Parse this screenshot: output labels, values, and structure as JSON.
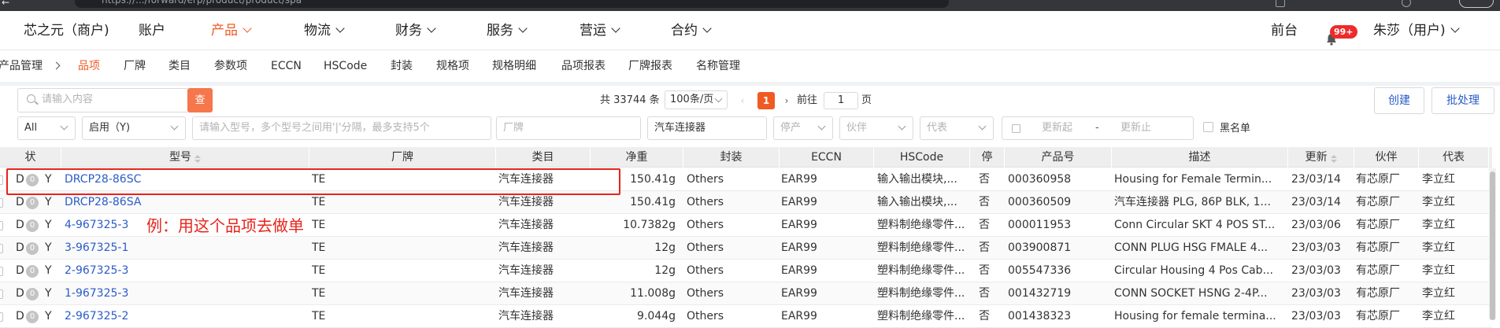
{
  "browser": {
    "url": "https://.../forward/erp/product/product/spa"
  },
  "topnav": {
    "brand": "芯之元（商户)",
    "items": [
      {
        "label": "账户",
        "dropdown": false,
        "active": false
      },
      {
        "label": "产品",
        "dropdown": true,
        "active": true
      },
      {
        "label": "物流",
        "dropdown": true,
        "active": false
      },
      {
        "label": "财务",
        "dropdown": true,
        "active": false
      },
      {
        "label": "服务",
        "dropdown": true,
        "active": false
      },
      {
        "label": "营运",
        "dropdown": true,
        "active": false
      },
      {
        "label": "合约",
        "dropdown": true,
        "active": false
      }
    ],
    "front_desk": "前台",
    "notifications_badge": "99+",
    "user": "朱莎（用户)"
  },
  "subnav": {
    "breadcrumb_root": "产品管理",
    "tabs": [
      "品项",
      "厂牌",
      "类目",
      "参数项",
      "ECCN",
      "HSCode",
      "封装",
      "规格项",
      "规格明细",
      "品项报表",
      "厂牌报表",
      "名称管理"
    ],
    "active": "品项"
  },
  "toolbar": {
    "search_placeholder": "请输入内容",
    "search_button": "查",
    "total_text": "共 33744 条",
    "page_size": "100条/页",
    "current_page": "1",
    "goto_label": "前往",
    "goto_value": "1",
    "goto_suffix": "页",
    "create_button": "创建",
    "batch_button": "批处理"
  },
  "filters": {
    "scope": "All",
    "enabled": "启用（Y)",
    "model_placeholder": "请输入型号，多个型号之间用'|'分隔，最多支持5个",
    "brand_placeholder": "厂牌",
    "category_value": "汽车连接器",
    "stop_placeholder": "停产",
    "partner_placeholder": "伙伴",
    "rep_placeholder": "代表",
    "update_start_placeholder": "更新起",
    "date_sep": "-",
    "update_end_placeholder": "更新止",
    "blacklist_label": "黑名单"
  },
  "table": {
    "headers": {
      "status": "状",
      "model": "型号",
      "brand": "厂牌",
      "category": "类目",
      "weight": "净重",
      "package": "封装",
      "eccn": "ECCN",
      "hscode": "HSCode",
      "stop": "停",
      "product_no": "产品号",
      "desc": "描述",
      "updated": "更新",
      "partner": "伙伴",
      "rep": "代表"
    },
    "rows": [
      {
        "s1": "D",
        "s2": "0",
        "s3": "Y",
        "model": "DRCP28-86SC",
        "brand": "TE",
        "category": "汽车连接器",
        "weight": "150.41g",
        "package": "Others",
        "eccn": "EAR99",
        "hscode": "输入输出模块,...",
        "stop": "否",
        "product_no": "000360958",
        "desc": "Housing for Female Termin...",
        "updated": "23/03/14",
        "partner": "有芯原厂",
        "rep": "李立红"
      },
      {
        "s1": "D",
        "s2": "0",
        "s3": "Y",
        "model": "DRCP28-86SA",
        "brand": "TE",
        "category": "汽车连接器",
        "weight": "150.41g",
        "package": "Others",
        "eccn": "EAR99",
        "hscode": "输入输出模块,...",
        "stop": "否",
        "product_no": "000360509",
        "desc": "汽车连接器 PLG, 86P BLK, 1...",
        "updated": "23/03/14",
        "partner": "有芯原厂",
        "rep": "李立红"
      },
      {
        "s1": "D",
        "s2": "0",
        "s3": "Y",
        "model": "4-967325-3",
        "brand": "TE",
        "category": "汽车连接器",
        "weight": "10.7382g",
        "package": "Others",
        "eccn": "EAR99",
        "hscode": "塑料制绝缘零件...",
        "stop": "否",
        "product_no": "000011953",
        "desc": "Conn Circular SKT 4 POS ST...",
        "updated": "23/03/06",
        "partner": "有芯原厂",
        "rep": "李立红"
      },
      {
        "s1": "D",
        "s2": "0",
        "s3": "Y",
        "model": "3-967325-1",
        "brand": "TE",
        "category": "汽车连接器",
        "weight": "12g",
        "package": "Others",
        "eccn": "EAR99",
        "hscode": "塑料制绝缘零件...",
        "stop": "否",
        "product_no": "003900871",
        "desc": "CONN PLUG HSG FMALE 4...",
        "updated": "23/03/03",
        "partner": "有芯原厂",
        "rep": "李立红"
      },
      {
        "s1": "D",
        "s2": "0",
        "s3": "Y",
        "model": "2-967325-3",
        "brand": "TE",
        "category": "汽车连接器",
        "weight": "12g",
        "package": "Others",
        "eccn": "EAR99",
        "hscode": "塑料制绝缘零件...",
        "stop": "否",
        "product_no": "005547336",
        "desc": "Circular Housing 4 Pos Cab...",
        "updated": "23/03/03",
        "partner": "有芯原厂",
        "rep": "李立红"
      },
      {
        "s1": "D",
        "s2": "0",
        "s3": "Y",
        "model": "1-967325-3",
        "brand": "TE",
        "category": "汽车连接器",
        "weight": "11.008g",
        "package": "Others",
        "eccn": "EAR99",
        "hscode": "塑料制绝缘零件...",
        "stop": "否",
        "product_no": "001432719",
        "desc": "CONN SOCKET HSNG 2-4P...",
        "updated": "23/03/03",
        "partner": "有芯原厂",
        "rep": "李立红"
      },
      {
        "s1": "D",
        "s2": "0",
        "s3": "Y",
        "model": "2-967325-2",
        "brand": "TE",
        "category": "汽车连接器",
        "weight": "9.044g",
        "package": "Others",
        "eccn": "EAR99",
        "hscode": "塑料制绝缘零件...",
        "stop": "否",
        "product_no": "001438323",
        "desc": "Housing for female termina...",
        "updated": "23/03/03",
        "partner": "有芯原厂",
        "rep": "李立红"
      }
    ]
  },
  "annotation": {
    "text": "例：用这个品项去做单",
    "color": "#e8231b"
  },
  "colors": {
    "accent": "#f05a23",
    "link": "#2a5cc8",
    "badge": "#ee2a2a"
  }
}
